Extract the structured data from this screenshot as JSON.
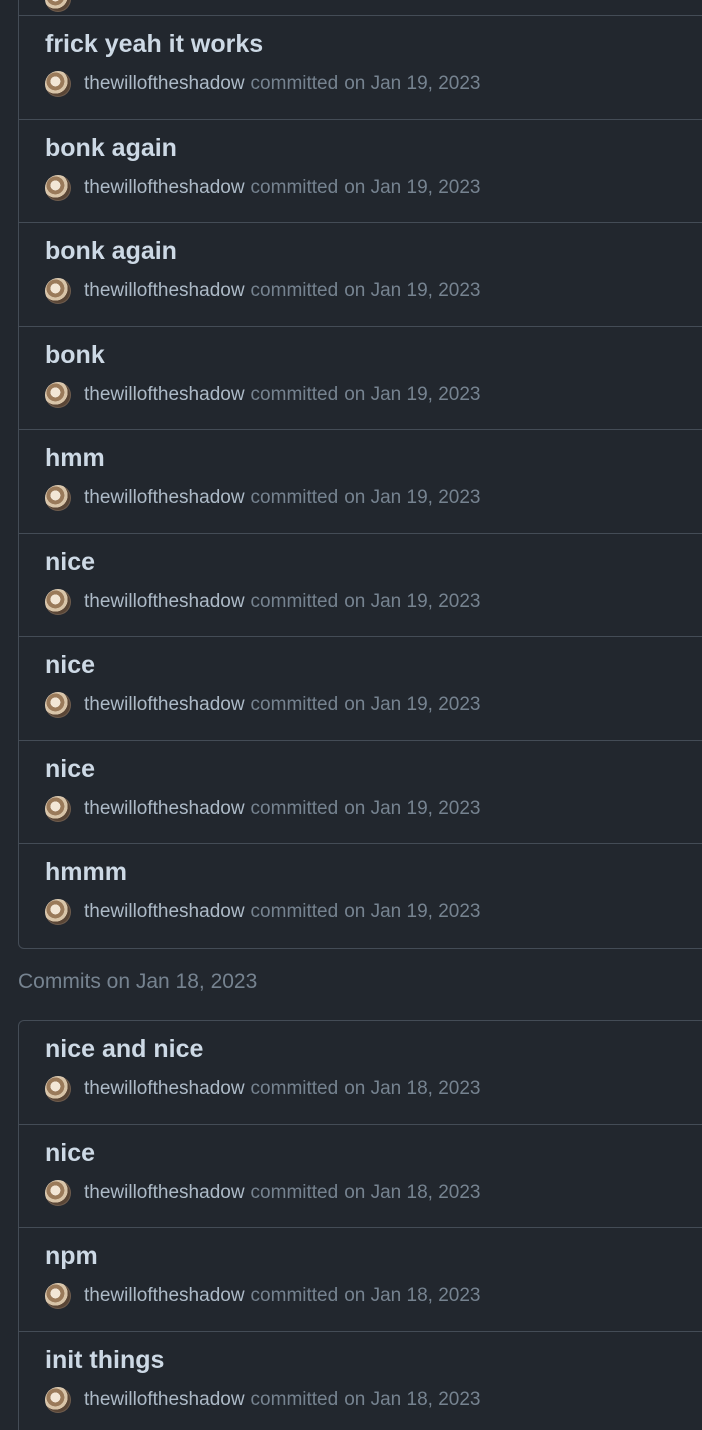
{
  "groups": [
    {
      "heading": "",
      "commits": [
        {
          "title": "frick yeah it works",
          "author": "thewilloftheshadow",
          "verb": "committed",
          "date": "on Jan 19, 2023"
        },
        {
          "title": "bonk again",
          "author": "thewilloftheshadow",
          "verb": "committed",
          "date": "on Jan 19, 2023"
        },
        {
          "title": "bonk again",
          "author": "thewilloftheshadow",
          "verb": "committed",
          "date": "on Jan 19, 2023"
        },
        {
          "title": "bonk",
          "author": "thewilloftheshadow",
          "verb": "committed",
          "date": "on Jan 19, 2023"
        },
        {
          "title": "hmm",
          "author": "thewilloftheshadow",
          "verb": "committed",
          "date": "on Jan 19, 2023"
        },
        {
          "title": "nice",
          "author": "thewilloftheshadow",
          "verb": "committed",
          "date": "on Jan 19, 2023"
        },
        {
          "title": "nice",
          "author": "thewilloftheshadow",
          "verb": "committed",
          "date": "on Jan 19, 2023"
        },
        {
          "title": "nice",
          "author": "thewilloftheshadow",
          "verb": "committed",
          "date": "on Jan 19, 2023"
        },
        {
          "title": "hmmm",
          "author": "thewilloftheshadow",
          "verb": "committed",
          "date": "on Jan 19, 2023"
        }
      ]
    },
    {
      "heading": "Commits on Jan 18, 2023",
      "commits": [
        {
          "title": "nice and nice",
          "author": "thewilloftheshadow",
          "verb": "committed",
          "date": "on Jan 18, 2023"
        },
        {
          "title": "nice",
          "author": "thewilloftheshadow",
          "verb": "committed",
          "date": "on Jan 18, 2023"
        },
        {
          "title": "npm",
          "author": "thewilloftheshadow",
          "verb": "committed",
          "date": "on Jan 18, 2023"
        },
        {
          "title": "init things",
          "author": "thewilloftheshadow",
          "verb": "committed",
          "date": "on Jan 18, 2023"
        }
      ]
    }
  ],
  "icons": {
    "avatar": "user-avatar-icon"
  },
  "colors": {
    "background": "#22272e",
    "border": "#444c56",
    "title": "#cdd9e5",
    "muted": "#768390"
  }
}
